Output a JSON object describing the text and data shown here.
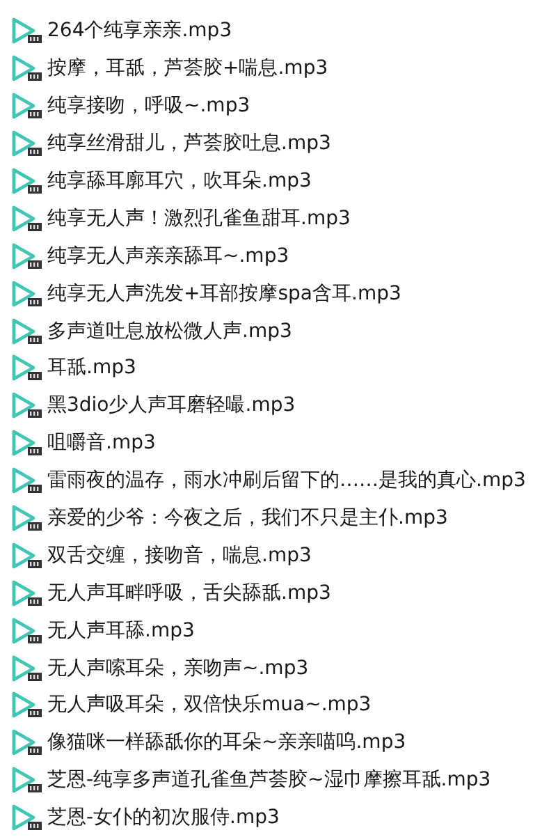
{
  "files": [
    {
      "name": "264个纯享亲亲.mp3"
    },
    {
      "name": "按摩，耳舐，芦荟胶+喘息.mp3"
    },
    {
      "name": "纯享接吻，呼吸~.mp3"
    },
    {
      "name": "纯享丝滑甜儿，芦荟胶吐息.mp3"
    },
    {
      "name": "纯享舔耳廓耳穴，吹耳朵.mp3"
    },
    {
      "name": "纯享无人声！激烈孔雀鱼甜耳.mp3"
    },
    {
      "name": "纯享无人声亲亲舔耳~.mp3"
    },
    {
      "name": "纯享无人声洗发+耳部按摩spa含耳.mp3"
    },
    {
      "name": "多声道吐息放松微人声.mp3"
    },
    {
      "name": "耳舐.mp3"
    },
    {
      "name": "黑3dio少人声耳磨轻嘬.mp3"
    },
    {
      "name": "咀嚼音.mp3"
    },
    {
      "name": "雷雨夜的温存，雨水冲刷后留下的……是我的真心.mp3"
    },
    {
      "name": "亲爱的少爷：今夜之后，我们不只是主仆.mp3"
    },
    {
      "name": "双舌交缠，接吻音，喘息.mp3"
    },
    {
      "name": "无人声耳畔呼吸，舌尖舔舐.mp3"
    },
    {
      "name": "无人声耳舔.mp3"
    },
    {
      "name": "无人声嗦耳朵，亲吻声~.mp3"
    },
    {
      "name": "无人声吸耳朵，双倍快乐mua~.mp3"
    },
    {
      "name": "像猫咪一样舔舐你的耳朵~亲亲喵呜.mp3"
    },
    {
      "name": "芝恩-纯享多声道孔雀鱼芦荟胶~湿巾摩擦耳舐.mp3"
    },
    {
      "name": "芝恩-女仆的初次服侍.mp3"
    }
  ]
}
